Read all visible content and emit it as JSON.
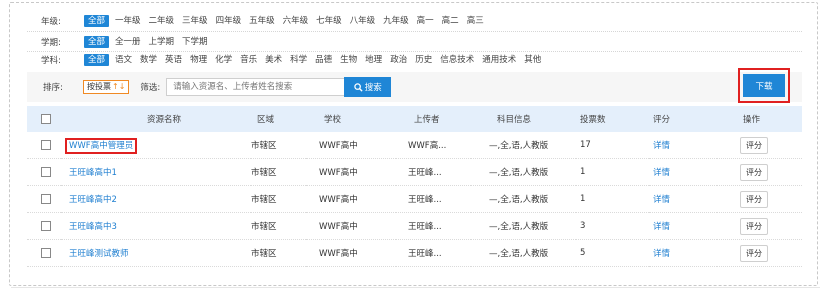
{
  "filters": {
    "grade": {
      "label": "年级:",
      "options": [
        "全部",
        "一年级",
        "二年级",
        "三年级",
        "四年级",
        "五年级",
        "六年级",
        "七年级",
        "八年级",
        "九年级",
        "高一",
        "高二",
        "高三"
      ],
      "active": 0
    },
    "term": {
      "label": "学期:",
      "options": [
        "全部",
        "全一册",
        "上学期",
        "下学期"
      ],
      "active": 0
    },
    "subject": {
      "label": "学科:",
      "options": [
        "全部",
        "语文",
        "数学",
        "英语",
        "物理",
        "化学",
        "音乐",
        "美术",
        "科学",
        "品德",
        "生物",
        "地理",
        "政治",
        "历史",
        "信息技术",
        "通用技术",
        "其他"
      ],
      "active": 0
    }
  },
  "sortbar": {
    "label": "排序:",
    "sort_button": "按投票",
    "sort_arrow": "↑↓",
    "screen_label": "筛选:",
    "search_placeholder": "请输入资源名、上传者姓名搜索",
    "search_button": "搜索",
    "download_button": "下载"
  },
  "table": {
    "headers": [
      "资源名称",
      "区域",
      "学校",
      "上传者",
      "科目信息",
      "投票数",
      "评分",
      "操作"
    ],
    "rows": [
      {
        "name": "WWF高中管理员",
        "region": "市辖区",
        "school": "WWF高中",
        "uploader": "WWF高...",
        "subject": "—,全,语,人教版",
        "votes": "17",
        "detail": "详情",
        "action": "评分"
      },
      {
        "name": "王旺峰高中1",
        "region": "市辖区",
        "school": "WWF高中",
        "uploader": "王旺峰...",
        "subject": "—,全,语,人教版",
        "votes": "1",
        "detail": "详情",
        "action": "评分"
      },
      {
        "name": "王旺峰高中2",
        "region": "市辖区",
        "school": "WWF高中",
        "uploader": "王旺峰...",
        "subject": "—,全,语,人教版",
        "votes": "1",
        "detail": "详情",
        "action": "评分"
      },
      {
        "name": "王旺峰高中3",
        "region": "市辖区",
        "school": "WWF高中",
        "uploader": "王旺峰...",
        "subject": "—,全,语,人教版",
        "votes": "3",
        "detail": "详情",
        "action": "评分"
      },
      {
        "name": "王旺峰测试教师",
        "region": "市辖区",
        "school": "WWF高中",
        "uploader": "王旺峰...",
        "subject": "—,全,语,人教版",
        "votes": "5",
        "detail": "详情",
        "action": "评分"
      }
    ]
  },
  "colors": {
    "accent": "#1f86d6",
    "highlight_border": "#e02020",
    "sort_border": "#f08a24",
    "header_bg": "#e4effb"
  }
}
